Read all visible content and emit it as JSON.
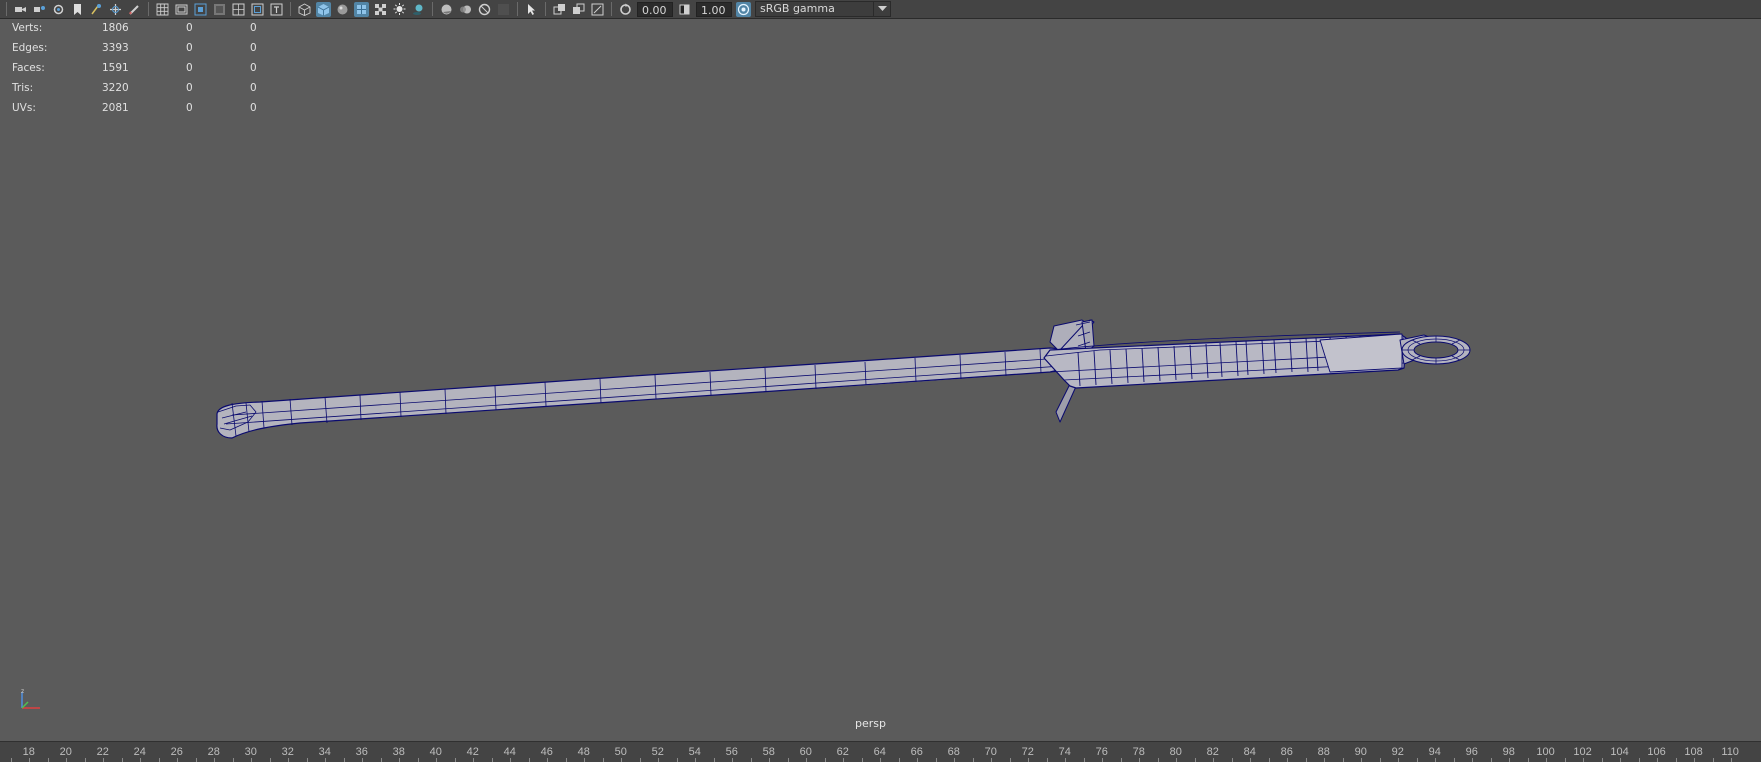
{
  "toolbar": {
    "exposure_value": "0.00",
    "gamma_value": "1.00",
    "color_space": "sRGB gamma",
    "icons_left": [
      "camera-icon",
      "camera-attributes-icon",
      "bookmark-icon",
      "image-plane-icon",
      "film-gate-icon",
      "pan-zoom-icon",
      "grease-pencil-icon"
    ],
    "icons_grid": [
      "grid-icon",
      "film-gate-toggle-icon",
      "resolution-gate-icon",
      "gate-mask-icon",
      "field-chart-icon",
      "safe-action-icon",
      "safe-title-icon"
    ],
    "icons_shading": [
      "wireframe-icon",
      "smooth-shade-icon",
      "use-default-material-icon",
      "wireframe-on-shaded-icon",
      "textured-icon",
      "lights-icon",
      "shadows-icon"
    ],
    "icons_render": [
      "screen-space-ao-icon",
      "motion-blur-icon",
      "anti-aliasing-icon",
      "depth-of-field-icon"
    ],
    "icons_misc": [
      "isolate-select-icon",
      "xray-icon",
      "xray-active-icon",
      "xray-joints-icon",
      "exposure-reset-icon",
      "gamma-icon",
      "color-management-icon"
    ]
  },
  "hud": {
    "rows": [
      {
        "label": "Verts:",
        "v1": "1806",
        "v2": "0",
        "v3": "0"
      },
      {
        "label": "Edges:",
        "v1": "3393",
        "v2": "0",
        "v3": "0"
      },
      {
        "label": "Faces:",
        "v1": "1591",
        "v2": "0",
        "v3": "0"
      },
      {
        "label": "Tris:",
        "v1": "3220",
        "v2": "0",
        "v3": "0"
      },
      {
        "label": "UVs:",
        "v1": "2081",
        "v2": "0",
        "v3": "0"
      }
    ]
  },
  "viewport": {
    "camera": "persp",
    "background": "#5b5b5b",
    "wire_color": "#0a0a6e",
    "mesh_fill": "#b6b6c0"
  },
  "timeline": {
    "ticks": [
      "18",
      "20",
      "22",
      "24",
      "26",
      "28",
      "30",
      "32",
      "34",
      "36",
      "38",
      "40",
      "42",
      "44",
      "46",
      "48",
      "50",
      "52",
      "54",
      "56",
      "58",
      "60",
      "62",
      "64",
      "66",
      "68",
      "70",
      "72",
      "74",
      "76",
      "78",
      "80",
      "82",
      "84",
      "86",
      "88",
      "90",
      "92",
      "94",
      "96",
      "98",
      "100",
      "102",
      "104",
      "106",
      "108",
      "110"
    ]
  }
}
